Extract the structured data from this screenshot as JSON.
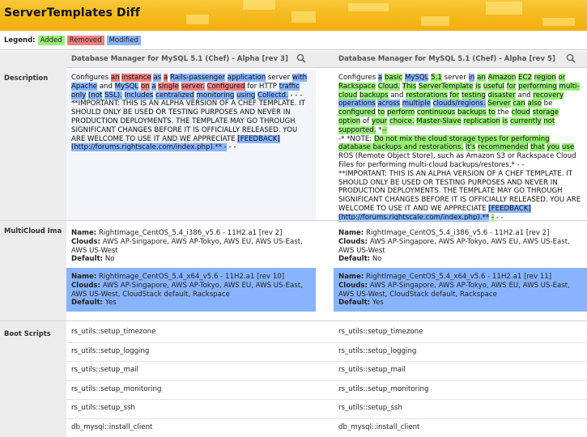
{
  "title": "ServerTemplates Diff",
  "legend": {
    "label": "Legend:",
    "added": "Added",
    "removed": "Removed",
    "modified": "Modified"
  },
  "columns": {
    "left": "Database Manager for MySQL 5.1 (Chef) - Alpha [rev 3]",
    "right": "Database Manager for MySQL 5.1 (Chef) - Alpha [rev 5]"
  },
  "rows": {
    "description": "Description",
    "multicloud": "MultiCloud Ima",
    "boot_scripts": "Boot Scripts"
  },
  "description": {
    "left": [
      {
        "t": "Configures ",
        "c": ""
      },
      {
        "t": "an",
        "c": "rem"
      },
      {
        "t": " ",
        "c": ""
      },
      {
        "t": "instance",
        "c": "rem"
      },
      {
        "t": " ",
        "c": ""
      },
      {
        "t": "as",
        "c": "mod"
      },
      {
        "t": " ",
        "c": ""
      },
      {
        "t": "a",
        "c": "rem"
      },
      {
        "t": " ",
        "c": ""
      },
      {
        "t": "Rails-passenger",
        "c": "mod"
      },
      {
        "t": " ",
        "c": ""
      },
      {
        "t": "application",
        "c": "mod"
      },
      {
        "t": " server ",
        "c": ""
      },
      {
        "t": "with",
        "c": "mod"
      },
      {
        "t": " ",
        "c": ""
      },
      {
        "t": "Apache",
        "c": "mod"
      },
      {
        "t": " and ",
        "c": ""
      },
      {
        "t": "MySQL",
        "c": "mod"
      },
      {
        "t": " ",
        "c": ""
      },
      {
        "t": "on",
        "c": "rem"
      },
      {
        "t": " ",
        "c": ""
      },
      {
        "t": "a",
        "c": "mod"
      },
      {
        "t": " ",
        "c": ""
      },
      {
        "t": "single",
        "c": "rem"
      },
      {
        "t": " ",
        "c": ""
      },
      {
        "t": "server.",
        "c": "rem"
      },
      {
        "t": " ",
        "c": ""
      },
      {
        "t": "Configured",
        "c": "rem"
      },
      {
        "t": " for HTTP ",
        "c": ""
      },
      {
        "t": "traffic",
        "c": "mod"
      },
      {
        "t": " ",
        "c": ""
      },
      {
        "t": "only",
        "c": "mod"
      },
      {
        "t": " ",
        "c": ""
      },
      {
        "t": "(not",
        "c": "mod"
      },
      {
        "t": " ",
        "c": ""
      },
      {
        "t": "SSL).",
        "c": "mod"
      },
      {
        "t": " ",
        "c": ""
      },
      {
        "t": "Includes",
        "c": "mod"
      },
      {
        "t": " ",
        "c": ""
      },
      {
        "t": "centralized",
        "c": "mod"
      },
      {
        "t": " ",
        "c": ""
      },
      {
        "t": "monitoring",
        "c": "mod"
      },
      {
        "t": " ",
        "c": ""
      },
      {
        "t": "using",
        "c": "mod"
      },
      {
        "t": " ",
        "c": ""
      },
      {
        "t": "Collectd.",
        "c": "mod"
      },
      {
        "t": " - - -",
        "c": ""
      },
      {
        "t": "\n**IMPORTANT: THIS IS AN ALPHA VERSION OF A CHEF TEMPLATE. IT SHOULD ONLY BE USED OR TESTING PURPOSES AND NEVER IN PRODUCTION DEPLOYMENTS. THE TEMPLATE MAY GO THROUGH SIGNIFICANT CHANGES BEFORE IT IS OFFICIALLY RELEASED. YOU ARE WELCOME TO USE IT AND WE APPRECIATE ",
        "c": ""
      },
      {
        "t": "[FEEDBACK]",
        "c": "mod"
      },
      {
        "t": "\n",
        "c": ""
      },
      {
        "t": "(http://forums.rightscale.com/index.php).** -",
        "c": "mod"
      },
      {
        "t": " - -",
        "c": ""
      }
    ],
    "right": [
      {
        "t": "Configures ",
        "c": ""
      },
      {
        "t": "a",
        "c": "mod"
      },
      {
        "t": " ",
        "c": ""
      },
      {
        "t": "basic",
        "c": "add"
      },
      {
        "t": " ",
        "c": ""
      },
      {
        "t": "MySQL",
        "c": "mod"
      },
      {
        "t": " ",
        "c": ""
      },
      {
        "t": "5.1",
        "c": "add"
      },
      {
        "t": " server ",
        "c": ""
      },
      {
        "t": "in",
        "c": "mod"
      },
      {
        "t": " ",
        "c": ""
      },
      {
        "t": "an",
        "c": "add"
      },
      {
        "t": " ",
        "c": ""
      },
      {
        "t": "Amazon",
        "c": "add"
      },
      {
        "t": " ",
        "c": ""
      },
      {
        "t": "EC2",
        "c": "add"
      },
      {
        "t": " ",
        "c": ""
      },
      {
        "t": "region",
        "c": "add"
      },
      {
        "t": " ",
        "c": ""
      },
      {
        "t": "or",
        "c": "add"
      },
      {
        "t": " ",
        "c": ""
      },
      {
        "t": "Rackspace",
        "c": "add"
      },
      {
        "t": " ",
        "c": ""
      },
      {
        "t": "Cloud.",
        "c": "add"
      },
      {
        "t": " ",
        "c": ""
      },
      {
        "t": "This",
        "c": "add"
      },
      {
        "t": " ",
        "c": ""
      },
      {
        "t": "ServerTemplate",
        "c": "add"
      },
      {
        "t": " ",
        "c": ""
      },
      {
        "t": "is",
        "c": "add"
      },
      {
        "t": " ",
        "c": ""
      },
      {
        "t": "useful",
        "c": "add"
      },
      {
        "t": " ",
        "c": ""
      },
      {
        "t": "for",
        "c": "add"
      },
      {
        "t": " ",
        "c": ""
      },
      {
        "t": "performing",
        "c": "add"
      },
      {
        "t": " ",
        "c": ""
      },
      {
        "t": "multi-cloud",
        "c": "add"
      },
      {
        "t": " ",
        "c": ""
      },
      {
        "t": "backups",
        "c": "add"
      },
      {
        "t": " and ",
        "c": ""
      },
      {
        "t": "restorations",
        "c": "add"
      },
      {
        "t": " ",
        "c": ""
      },
      {
        "t": "for",
        "c": "add"
      },
      {
        "t": " ",
        "c": ""
      },
      {
        "t": "testing",
        "c": "add"
      },
      {
        "t": " ",
        "c": ""
      },
      {
        "t": "disaster",
        "c": "add"
      },
      {
        "t": " and ",
        "c": ""
      },
      {
        "t": "recovery",
        "c": "add"
      },
      {
        "t": " ",
        "c": ""
      },
      {
        "t": "operations",
        "c": "mod"
      },
      {
        "t": " ",
        "c": ""
      },
      {
        "t": "across",
        "c": "mod"
      },
      {
        "t": " ",
        "c": ""
      },
      {
        "t": "multiple",
        "c": "mod"
      },
      {
        "t": " ",
        "c": ""
      },
      {
        "t": "clouds/regions.",
        "c": "mod"
      },
      {
        "t": " ",
        "c": ""
      },
      {
        "t": "Server",
        "c": "add"
      },
      {
        "t": " ",
        "c": ""
      },
      {
        "t": "can",
        "c": "add"
      },
      {
        "t": " ",
        "c": ""
      },
      {
        "t": "also",
        "c": "add"
      },
      {
        "t": " be ",
        "c": ""
      },
      {
        "t": "configured",
        "c": "add"
      },
      {
        "t": " ",
        "c": ""
      },
      {
        "t": "to",
        "c": "add"
      },
      {
        "t": " ",
        "c": ""
      },
      {
        "t": "perform",
        "c": "add"
      },
      {
        "t": " ",
        "c": ""
      },
      {
        "t": "continuous",
        "c": "add"
      },
      {
        "t": " ",
        "c": ""
      },
      {
        "t": "backups",
        "c": "add"
      },
      {
        "t": " ",
        "c": ""
      },
      {
        "t": "to",
        "c": "add"
      },
      {
        "t": " the ",
        "c": ""
      },
      {
        "t": "cloud",
        "c": "add"
      },
      {
        "t": " ",
        "c": ""
      },
      {
        "t": "storage",
        "c": "add"
      },
      {
        "t": " ",
        "c": ""
      },
      {
        "t": "option",
        "c": "add"
      },
      {
        "t": " of ",
        "c": ""
      },
      {
        "t": "your",
        "c": "add"
      },
      {
        "t": " ",
        "c": ""
      },
      {
        "t": "choice.",
        "c": "add"
      },
      {
        "t": " ",
        "c": ""
      },
      {
        "t": "Master-Slave",
        "c": "add"
      },
      {
        "t": " ",
        "c": ""
      },
      {
        "t": "replication",
        "c": "add"
      },
      {
        "t": " ",
        "c": ""
      },
      {
        "t": "is",
        "c": "add"
      },
      {
        "t": " ",
        "c": ""
      },
      {
        "t": "currently",
        "c": "add"
      },
      {
        "t": " ",
        "c": ""
      },
      {
        "t": "not",
        "c": "add"
      },
      {
        "t": " ",
        "c": ""
      },
      {
        "t": "supported.",
        "c": "add"
      },
      {
        "t": " *",
        "c": ""
      },
      {
        "t": "--",
        "c": "add"
      },
      {
        "t": "\n-* *NOTE: ",
        "c": ""
      },
      {
        "t": "Do not mix the cloud storage types for performing database backups and restorations.",
        "c": "add"
      },
      {
        "t": " ",
        "c": ""
      },
      {
        "t": "It's",
        "c": "add"
      },
      {
        "t": " ",
        "c": ""
      },
      {
        "t": "recommended",
        "c": "add"
      },
      {
        "t": " ",
        "c": ""
      },
      {
        "t": "that",
        "c": "add"
      },
      {
        "t": " ",
        "c": ""
      },
      {
        "t": "you",
        "c": "add"
      },
      {
        "t": " ",
        "c": ""
      },
      {
        "t": "use",
        "c": "add"
      },
      {
        "t": "\nROS (Remote Object Store), such as Amazon S3 or Rackspace Cloud Files for performing multi-cloud backups/restores.* - -",
        "c": ""
      },
      {
        "t": "\n**IMPORTANT: THIS IS AN ALPHA VERSION OF A CHEF TEMPLATE. IT SHOULD ONLY BE USED OR TESTING PURPOSES AND NEVER IN PRODUCTION DEPLOYMENTS. THE TEMPLATE MAY GO THROUGH SIGNIFICANT CHANGES BEFORE IT IS OFFICIALLY RELEASED. YOU ARE WELCOME TO USE IT AND WE APPRECIATE ",
        "c": ""
      },
      {
        "t": "[FEEDBACK]",
        "c": "mod"
      },
      {
        "t": "\n",
        "c": ""
      },
      {
        "t": "(http://forums.rightscale.com/index.php).**",
        "c": "mod"
      },
      {
        "t": " ",
        "c": ""
      },
      {
        "t": "-",
        "c": "add"
      },
      {
        "t": " - -",
        "c": ""
      }
    ]
  },
  "images": {
    "left": [
      {
        "name": "RightImage_CentOS_5.4_i386_v5.6 - 11H2.a1 [rev 2]",
        "clouds": "AWS AP-Singapore, AWS AP-Tokyo, AWS EU, AWS US-East, AWS US-West",
        "default": "No",
        "modified": false
      },
      {
        "name": "RightImage_CentOS_5.4_x64_v5.6 - 11H2.a1 [rev 10]",
        "clouds": "AWS AP-Singapore, AWS AP-Tokyo, AWS EU, AWS US-East, AWS US-West, CloudStack default, Rackspace",
        "default": "Yes",
        "modified": true
      }
    ],
    "right": [
      {
        "name": "RightImage_CentOS_5.4_i386_v5.6 - 11H2.a1 [rev 2]",
        "clouds": "AWS AP-Singapore, AWS AP-Tokyo, AWS EU, AWS US-East, AWS US-West",
        "default": "No",
        "modified": false
      },
      {
        "name": "RightImage_CentOS_5.4_x64_v5.6 - 11H2.a1 [rev 11]",
        "clouds": "AWS AP-Singapore, AWS AP-Tokyo, AWS EU, AWS US-East, AWS US-West, CloudStack default, Rackspace",
        "default": "Yes",
        "modified": true
      }
    ],
    "labels": {
      "name": "Name:",
      "clouds": "Clouds:",
      "default": "Default:"
    }
  },
  "boot_scripts": {
    "left": [
      "rs_utils::setup_timezone",
      "rs_utils::setup_logging",
      "rs_utils::setup_mail",
      "rs_utils::setup_monitoring",
      "rs_utils::setup_ssh",
      "db_mysql::install_client"
    ],
    "right": [
      "rs_utils::setup_timezone",
      "rs_utils::setup_logging",
      "rs_utils::setup_mail",
      "rs_utils::setup_monitoring",
      "rs_utils::setup_ssh",
      "db_mysql::install_client"
    ]
  }
}
